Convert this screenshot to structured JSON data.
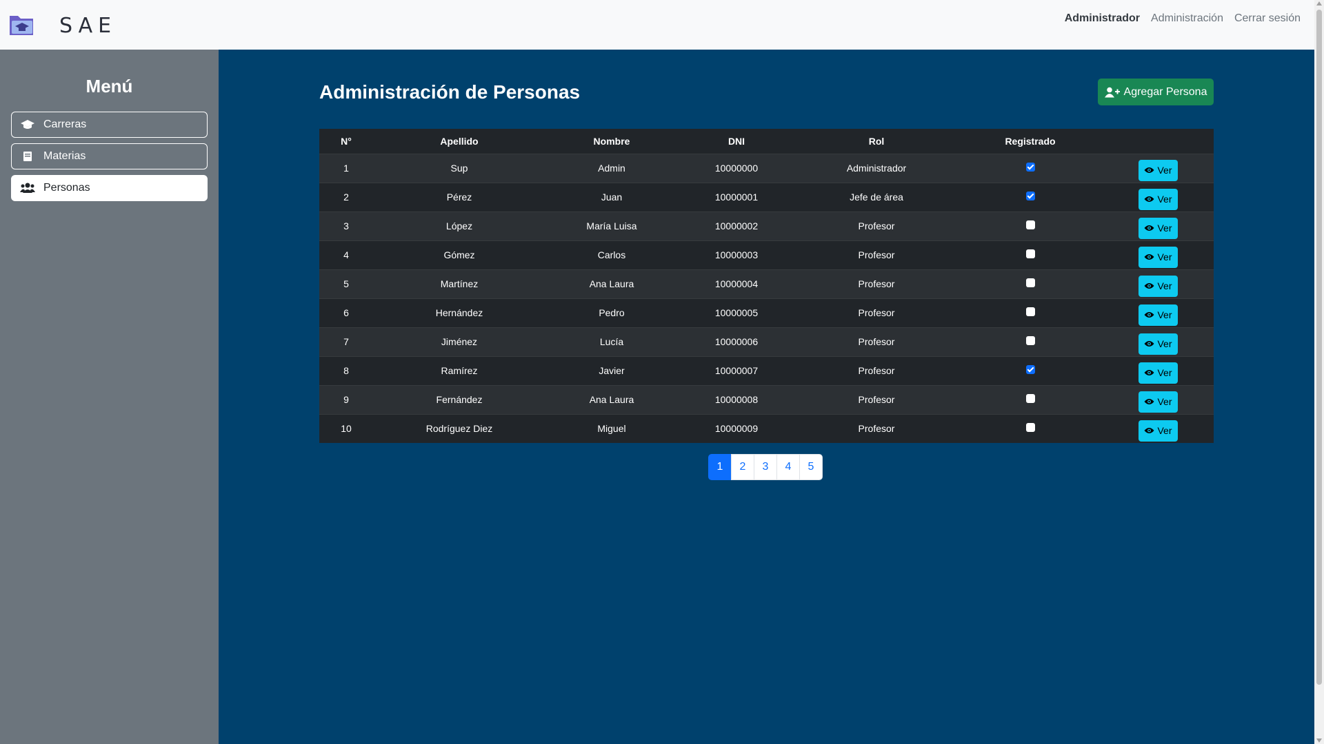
{
  "navbar": {
    "brand": "SAE",
    "links": [
      {
        "label": "Administrador",
        "active": true
      },
      {
        "label": "Administración",
        "active": false
      },
      {
        "label": "Cerrar sesión",
        "active": false
      }
    ]
  },
  "sidebar": {
    "title": "Menú",
    "items": [
      {
        "label": "Carreras",
        "icon": "graduation-cap-icon",
        "active": false
      },
      {
        "label": "Materias",
        "icon": "book-icon",
        "active": false
      },
      {
        "label": "Personas",
        "icon": "users-icon",
        "active": true
      }
    ]
  },
  "main": {
    "title": "Administración de Personas",
    "add_button_label": "Agregar Persona",
    "table": {
      "headers": [
        "N°",
        "Apellido",
        "Nombre",
        "DNI",
        "Rol",
        "Registrado",
        ""
      ],
      "view_label": "Ver",
      "rows": [
        {
          "n": "1",
          "apellido": "Sup",
          "nombre": "Admin",
          "dni": "10000000",
          "rol": "Administrador",
          "registrado": true
        },
        {
          "n": "2",
          "apellido": "Pérez",
          "nombre": "Juan",
          "dni": "10000001",
          "rol": "Jefe de área",
          "registrado": true
        },
        {
          "n": "3",
          "apellido": "López",
          "nombre": "María Luisa",
          "dni": "10000002",
          "rol": "Profesor",
          "registrado": false
        },
        {
          "n": "4",
          "apellido": "Gómez",
          "nombre": "Carlos",
          "dni": "10000003",
          "rol": "Profesor",
          "registrado": false
        },
        {
          "n": "5",
          "apellido": "Martínez",
          "nombre": "Ana Laura",
          "dni": "10000004",
          "rol": "Profesor",
          "registrado": false
        },
        {
          "n": "6",
          "apellido": "Hernández",
          "nombre": "Pedro",
          "dni": "10000005",
          "rol": "Profesor",
          "registrado": false
        },
        {
          "n": "7",
          "apellido": "Jiménez",
          "nombre": "Lucía",
          "dni": "10000006",
          "rol": "Profesor",
          "registrado": false
        },
        {
          "n": "8",
          "apellido": "Ramírez",
          "nombre": "Javier",
          "dni": "10000007",
          "rol": "Profesor",
          "registrado": true
        },
        {
          "n": "9",
          "apellido": "Fernández",
          "nombre": "Ana Laura",
          "dni": "10000008",
          "rol": "Profesor",
          "registrado": false
        },
        {
          "n": "10",
          "apellido": "Rodríguez Diez",
          "nombre": "Miguel",
          "dni": "10000009",
          "rol": "Profesor",
          "registrado": false
        }
      ]
    },
    "pagination": {
      "pages": [
        "1",
        "2",
        "3",
        "4",
        "5"
      ],
      "current": "1"
    }
  },
  "colors": {
    "main_bg": "#00416d",
    "sidebar_bg": "#6c757d",
    "add_button": "#198754",
    "view_button": "#0dcaf0",
    "primary": "#0d6efd"
  }
}
